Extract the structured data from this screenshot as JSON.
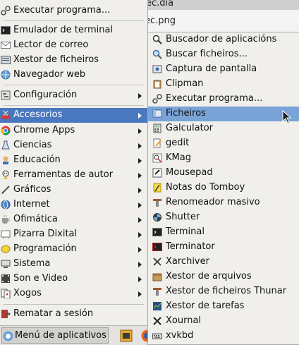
{
  "background_files": [
    "ffec.dia",
    "ec.png"
  ],
  "main_menu": {
    "items": [
      {
        "label": "Executar programa...",
        "icon": "run-gears-icon"
      },
      {
        "label": "Emulador de terminal",
        "icon": "terminal-icon"
      },
      {
        "label": "Lector de correo",
        "icon": "mail-icon"
      },
      {
        "label": "Xestor de ficheiros",
        "icon": "file-manager-icon"
      },
      {
        "label": "Navegador web",
        "icon": "globe-icon"
      },
      {
        "label": "Configuración",
        "icon": "settings-icon"
      },
      {
        "label": "Accesorios",
        "icon": "accessories-icon"
      },
      {
        "label": "Chrome Apps",
        "icon": "chrome-icon"
      },
      {
        "label": "Ciencias",
        "icon": "science-icon"
      },
      {
        "label": "Educación",
        "icon": "education-icon"
      },
      {
        "label": "Ferramentas de autor",
        "icon": "authoring-tools-icon"
      },
      {
        "label": "Gráficos",
        "icon": "graphics-icon"
      },
      {
        "label": "Internet",
        "icon": "internet-icon"
      },
      {
        "label": "Ofimática",
        "icon": "office-icon"
      },
      {
        "label": "Pizarra Dixital",
        "icon": "whiteboard-icon"
      },
      {
        "label": "Programación",
        "icon": "programming-icon"
      },
      {
        "label": "Sistema",
        "icon": "system-icon"
      },
      {
        "label": "Son e Video",
        "icon": "multimedia-icon"
      },
      {
        "label": "Xogos",
        "icon": "games-icon"
      },
      {
        "label": "Rematar a sesión",
        "icon": "logout-icon"
      }
    ],
    "active_item": "Accesorios"
  },
  "submenu": {
    "items": [
      {
        "label": "Buscador de aplicacións",
        "icon": "app-finder-icon"
      },
      {
        "label": "Buscar ficheiros...",
        "icon": "search-icon"
      },
      {
        "label": "Captura de pantalla",
        "icon": "screenshot-icon"
      },
      {
        "label": "Clipman",
        "icon": "clipboard-icon"
      },
      {
        "label": "Executar programa...",
        "icon": "run-gears-icon"
      },
      {
        "label": "Ficheiros",
        "icon": "files-icon"
      },
      {
        "label": "Galculator",
        "icon": "calculator-icon"
      },
      {
        "label": "gedit",
        "icon": "text-editor-icon"
      },
      {
        "label": "KMag",
        "icon": "magnifier-icon"
      },
      {
        "label": "Mousepad",
        "icon": "mousepad-icon"
      },
      {
        "label": "Notas do Tomboy",
        "icon": "notes-icon"
      },
      {
        "label": "Renomeador masivo",
        "icon": "bulk-rename-icon"
      },
      {
        "label": "Shutter",
        "icon": "shutter-icon"
      },
      {
        "label": "Terminal",
        "icon": "terminal-icon"
      },
      {
        "label": "Terminator",
        "icon": "terminator-icon"
      },
      {
        "label": "Xarchiver",
        "icon": "archive-icon"
      },
      {
        "label": "Xestor de arquivos",
        "icon": "archive-manager-icon"
      },
      {
        "label": "Xestor de ficheiros Thunar",
        "icon": "thunar-icon"
      },
      {
        "label": "Xestor de tarefas",
        "icon": "task-manager-icon"
      },
      {
        "label": "Xournal",
        "icon": "xournal-icon"
      },
      {
        "label": "xvkbd",
        "icon": "keyboard-icon"
      }
    ],
    "hovered_item": "Ficheiros"
  },
  "taskbar": {
    "app_menu_label": "Menú de aplicativos",
    "launchers": [
      "files-launcher-icon",
      "firefox-icon"
    ]
  },
  "colors": {
    "active_bg": "#4a78be",
    "hover_bg": "#7aa3d8",
    "menu_bg": "#f0efec"
  }
}
